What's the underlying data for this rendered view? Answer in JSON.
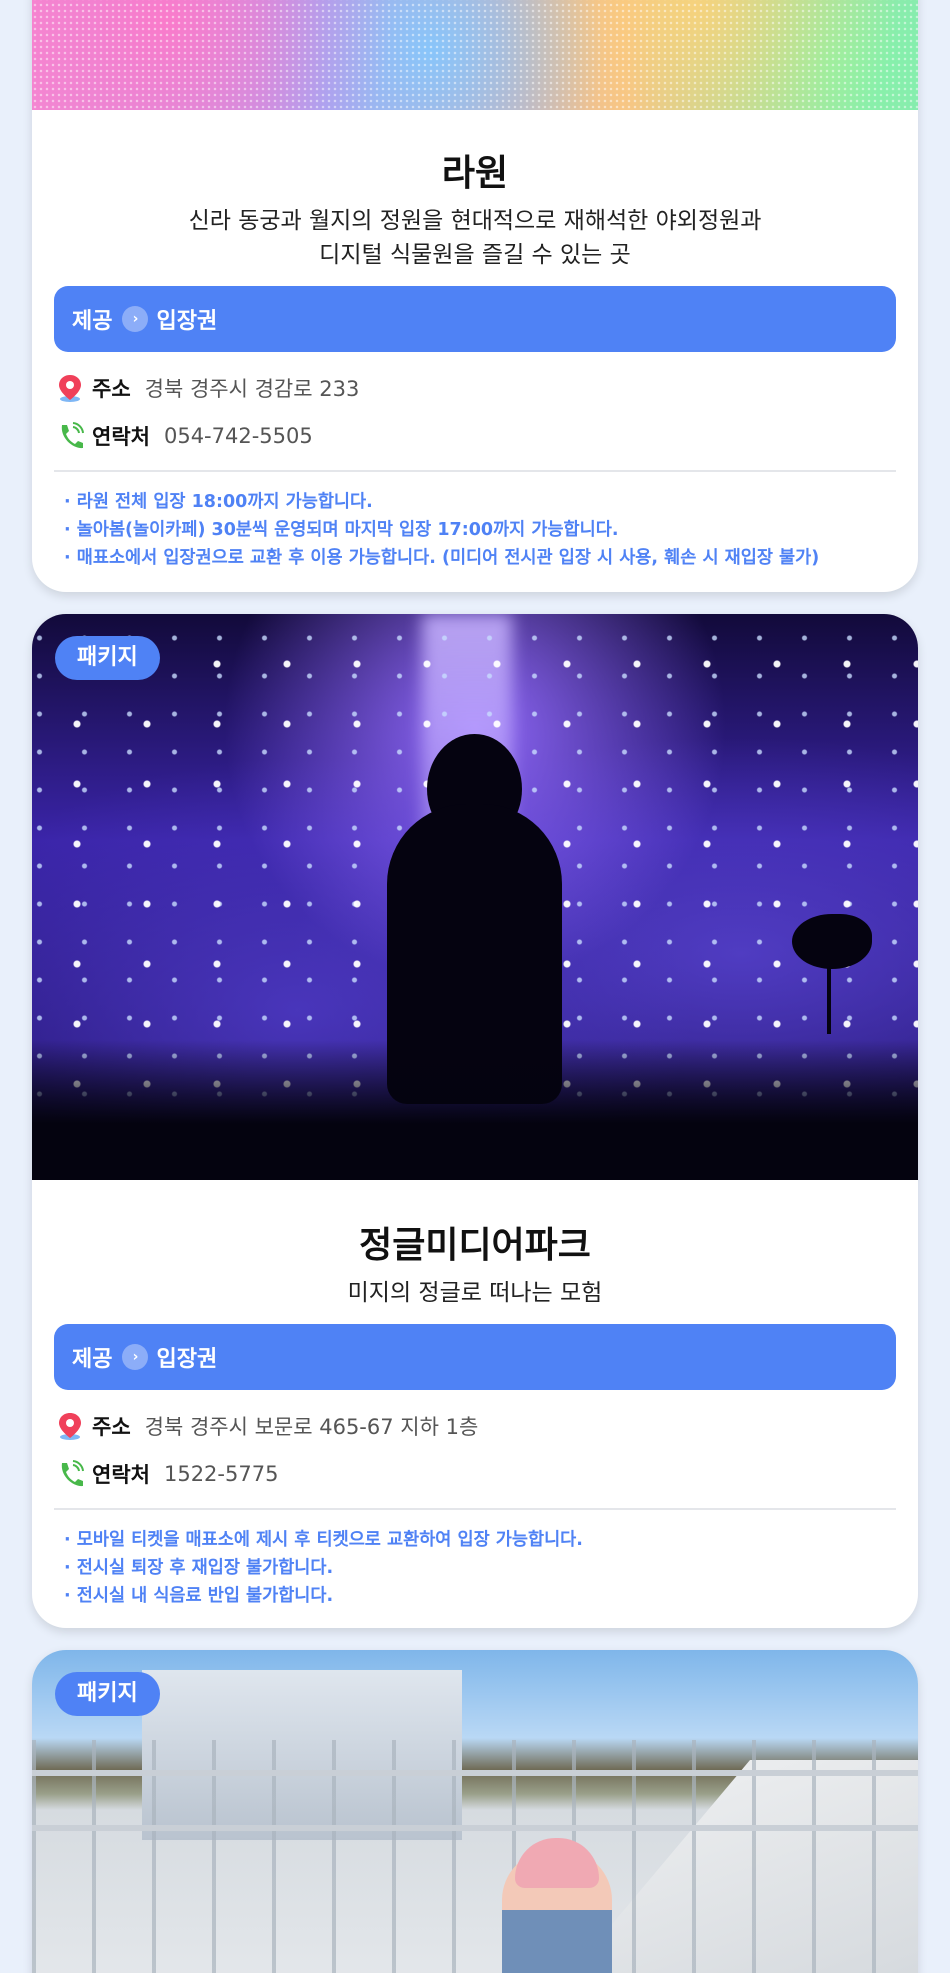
{
  "colors": {
    "accent": "#4f82f5",
    "page_background": "#e9f0fb",
    "card_background": "#ffffff",
    "pin_red": "#f0405a",
    "phone_green": "#48b84a"
  },
  "cards": [
    {
      "title": "라원",
      "description_line1": "신라 동궁과 월지의 정원을 현대적으로 재해석한 야외정원과",
      "description_line2": "디지털 식물원을 즐길 수 있는 곳",
      "provide_label": "제공",
      "provide_value": "입장권",
      "address_label": "주소",
      "address_value": "경북 경주시 경감로 233",
      "contact_label": "연락처",
      "contact_value": "054-742-5505",
      "notes": [
        "· 라원 전체 입장 18:00까지 가능합니다.",
        "· 놀아봄(놀이카페) 30분씩 운영되며 마지막 입장 17:00까지 가능합니다.",
        "· 매표소에서 입장권으로 교환 후 이용 가능합니다. (미디어 전시관 입장 시 사용, 훼손 시 재입장 불가)"
      ]
    },
    {
      "badge": "패키지",
      "title": "정글미디어파크",
      "description_line1": "미지의 정글로 떠나는 모험",
      "provide_label": "제공",
      "provide_value": "입장권",
      "address_label": "주소",
      "address_value": "경북 경주시 보문로 465-67 지하 1층",
      "contact_label": "연락처",
      "contact_value": "1522-5775",
      "notes": [
        "· 모바일 티켓을 매표소에 제시 후 티켓으로 교환하여 입장 가능합니다.",
        "·  전시실 퇴장 후 재입장 불가합니다.",
        "· 전시실 내 식음료 반입 불가합니다."
      ]
    },
    {
      "badge": "패키지"
    }
  ]
}
